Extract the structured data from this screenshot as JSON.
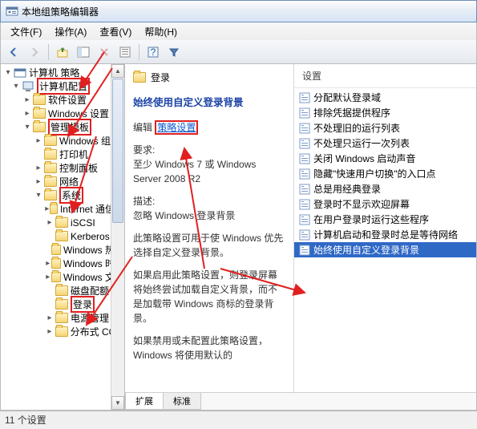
{
  "window": {
    "title": "本地组策略编辑器"
  },
  "menu": {
    "file": "文件(F)",
    "action": "操作(A)",
    "view": "查看(V)",
    "help": "帮助(H)"
  },
  "tree": {
    "root": "计算机 策略",
    "computer_config": "计算机配置",
    "software": "软件设置",
    "windows_settings": "Windows 设置",
    "admin_templates": "管理模板",
    "win_components": "Windows 组件",
    "printers": "打印机",
    "control_panel": "控制面板",
    "network": "网络",
    "system": "系统",
    "internet": "Internet 通信管",
    "iscsi": "iSCSI",
    "kerberos": "Kerberos",
    "win_hot": "Windows 热启",
    "win_time": "Windows 时间",
    "win_file": "Windows 文件",
    "disk_quota": "磁盘配额",
    "logon": "登录",
    "power": "电源管理",
    "distributed_com": "分布式 COM"
  },
  "breadcrumb": "登录",
  "detail": {
    "title": "始终使用自定义登录背景",
    "edit_label": "编辑",
    "policy_link": "策略设置",
    "req_label": "要求:",
    "req_value": "至少 Windows 7 或 Windows Server 2008 R2",
    "desc_label": "描述:",
    "desc_value": "忽略 Windows 登录背景",
    "body1": "此策略设置可用于使 Windows 优先选择自定义登录背景。",
    "body2": "如果启用此策略设置，则登录屏幕将始终尝试加载自定义背景，而不是加载带 Windows 商标的登录背景。",
    "body3": "如果禁用或未配置此策略设置，Windows 将使用默认的"
  },
  "settings": {
    "header": "设置",
    "items": [
      "分配默认登录域",
      "排除凭据提供程序",
      "不处理旧的运行列表",
      "不处理只运行一次列表",
      "关闭 Windows 启动声音",
      "隐藏\"快速用户切换\"的入口点",
      "总是用经典登录",
      "登录时不显示欢迎屏幕",
      "在用户登录时运行这些程序",
      "计算机启动和登录时总是等待网络",
      "始终使用自定义登录背景"
    ],
    "selected_index": 10
  },
  "tabs": {
    "extended": "扩展",
    "standard": "标准"
  },
  "status": "11 个设置"
}
